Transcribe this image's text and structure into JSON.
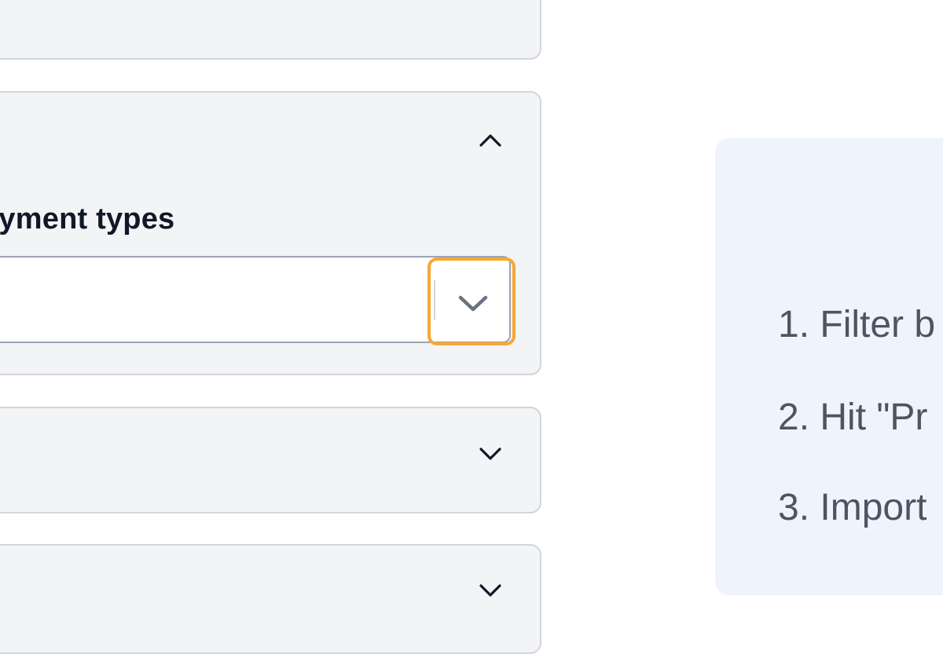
{
  "section_open": {
    "field_label": "oyment types",
    "select": {
      "value": "",
      "indicator_icon": "chevron-down-icon"
    },
    "collapse_icon": "chevron-up-icon"
  },
  "sections_collapsed": [
    {
      "expand_icon": "chevron-down-icon"
    },
    {
      "expand_icon": "chevron-down-icon"
    }
  ],
  "help_card": {
    "steps": [
      "1. Filter b",
      "2. Hit \"Pr",
      "3. Import"
    ]
  },
  "colors": {
    "highlight": "#f6a835",
    "card_bg": "#eff4fc",
    "panel_bg": "#f3f4f6"
  }
}
